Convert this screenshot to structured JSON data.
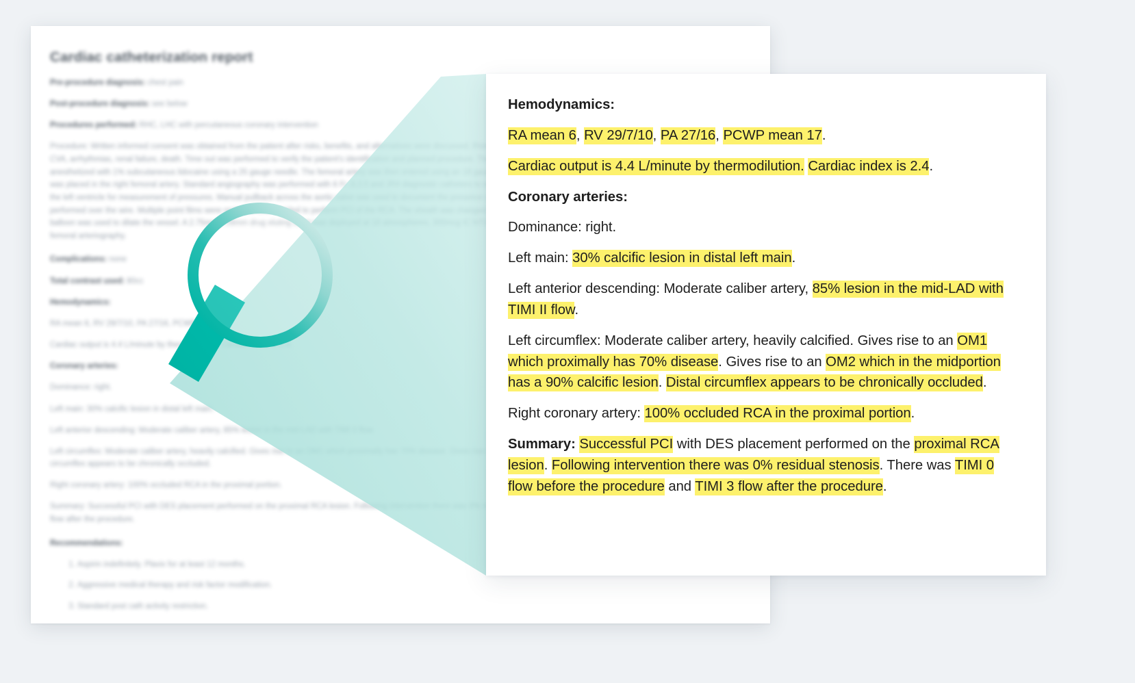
{
  "page": {
    "background_color": "#eff2f5",
    "highlight_color": "#fdf16c",
    "accent_color": "#00b5a5"
  },
  "document": {
    "title": "Cardiac catheterization report",
    "fields": [
      {
        "label": "Pre-procedure diagnosis:",
        "value": "chest pain"
      },
      {
        "label": "Post-procedure diagnosis:",
        "value": "see below"
      },
      {
        "label": "Procedures performed:",
        "value": "RHC, LHC with percutaneous coronary intervention"
      }
    ],
    "procedure_label": "Procedure:",
    "procedure_text": "Written informed consent was obtained from the patient after risks, benefits, and alternatives were discussed. Risks include but are not limited to infection, vascular complications, MI, CVA, arrhythmias, renal failure, death. Time out was performed to verify the patient's identification and planned procedure. The right groin was prepped and draped in sterile fashion, and anesthetized with 1% subcutaneous lidocaine using a 25 gauge needle. The femoral artery was then entered using an 18 gauge straight needle and using a modified seldinger technique a 6 F sheet was placed in the right femoral artery. Standard angiography was performed with 6 Fr JL3.5 and JR4 diagnostic catheters to engage the right coronary artery (RCA). A JR4 catheter was used to cross the left ventricle for measurement of pressures. Manual pullback across the aortic valve was used to document the presence of an aortic valve gradient. All catheter exchanges and removals were performed over the wire. Multiple point films were reviewed and decided to perform PCI of the RCA. The sheath was changed to a 7 Fr sheath due to the lesion. Then a 2.5X12mm non-compliant balloon was used to dilate the vessel. A 2.75mm x 28mm drug eluting stent was deployed at 18 atmospheres, 300mcg IC NTG was administered. Contrast was injected through the sheath to perform femoral arteriography.",
    "complications_label": "Complications:",
    "complications_value": "none",
    "contrast_label": "Total contrast used:",
    "contrast_value": "80cc",
    "hemodynamics_label": "Hemodynamics:",
    "hemodynamics_line1": "RA mean 6, RV 29/7/10, PA 27/16, PCWP mean 17.",
    "hemodynamics_line2": "Cardiac output is 4.4 L/minute by thermodilution. Cardiac index is 2.4.",
    "coronary_label": "Coronary arteries:",
    "coronary_lines": [
      "Dominance: right.",
      "Left main: 30% calcific lesion in distal left main.",
      "Left anterior descending: Moderate caliber artery, 85% lesion in the mid-LAD with TIMI II flow.",
      "Left circumflex: Moderate caliber artery, heavily calcified. Gives rise to an OM1 which proximally has 70% disease. Gives rise to an OM2 which in the midportion has a 90% calcific lesion. Distal circumflex appears to be chronically occluded.",
      "Right coronary artery: 100% occluded RCA in the proximal portion."
    ],
    "summary_label": "Summary:",
    "summary_text": "Successful PCI with DES placement performed on the proximal RCA lesion. Following intervention there was 0% residual stenosis. There was TIMI 0 flow before the procedure and TIMI 3 flow after the procedure.",
    "recommendations_label": "Recommendations:",
    "recommendations": [
      "Aspirin indefinitely. Plavix for at least 12 months.",
      "Aggressive medical therapy and risk factor modification.",
      "Standard post cath activity restriction."
    ]
  },
  "detail_panel": {
    "hemodynamics_heading": "Hemodynamics:",
    "hemo_l1": {
      "p1": "RA mean 6",
      "s1": ", ",
      "p2": "RV 29/7/10",
      "s2": ", ",
      "p3": "PA 27/16",
      "s3": ", ",
      "p4": "PCWP mean 17",
      "s4": "."
    },
    "hemo_l2": {
      "p1": "Cardiac output is 4.4 L/minute by thermodilution.",
      "s1": " ",
      "p2": "Cardiac index is 2.4",
      "s2": "."
    },
    "coronary_heading": "Coronary arteries:",
    "dominance": "Dominance: right.",
    "left_main": {
      "pre": "Left main: ",
      "hl": "30% calcific lesion in distal left main",
      "post": "."
    },
    "lad": {
      "pre": "Left anterior descending: Moderate caliber artery, ",
      "hl": "85% lesion in the mid-LAD with TIMI II flow",
      "post": "."
    },
    "lcx": {
      "pre": "Left circumflex: Moderate caliber artery, heavily calcified. Gives rise to an ",
      "hl1": "OM1 which proximally has 70% disease",
      "mid1": ". Gives rise to an ",
      "hl2": "OM2 which in the midportion has a 90% calcific lesion",
      "mid2": ". ",
      "hl3": "Distal circumflex appears to be chronically occluded",
      "post": "."
    },
    "rca": {
      "pre": "Right coronary artery: ",
      "hl": "100% occluded RCA in the proximal portion",
      "post": "."
    },
    "summary": {
      "label": "Summary:",
      "sp": " ",
      "hl1": "Successful PCI",
      "mid1": " with DES placement performed on the ",
      "hl2": "proximal RCA lesion",
      "mid2": ". ",
      "hl3": "Following intervention there was 0% residual stenosis",
      "mid3": ". There was ",
      "hl4": "TIMI 0 flow before the procedure",
      "mid4": " and ",
      "hl5": "TIMI 3 flow after the procedure",
      "post": "."
    }
  },
  "magnifier": {
    "icon": "magnifying-glass-icon",
    "ring_color_dark": "#00b5a5",
    "ring_color_light": "#bfe7e4",
    "handle_color": "#00b5a5"
  }
}
